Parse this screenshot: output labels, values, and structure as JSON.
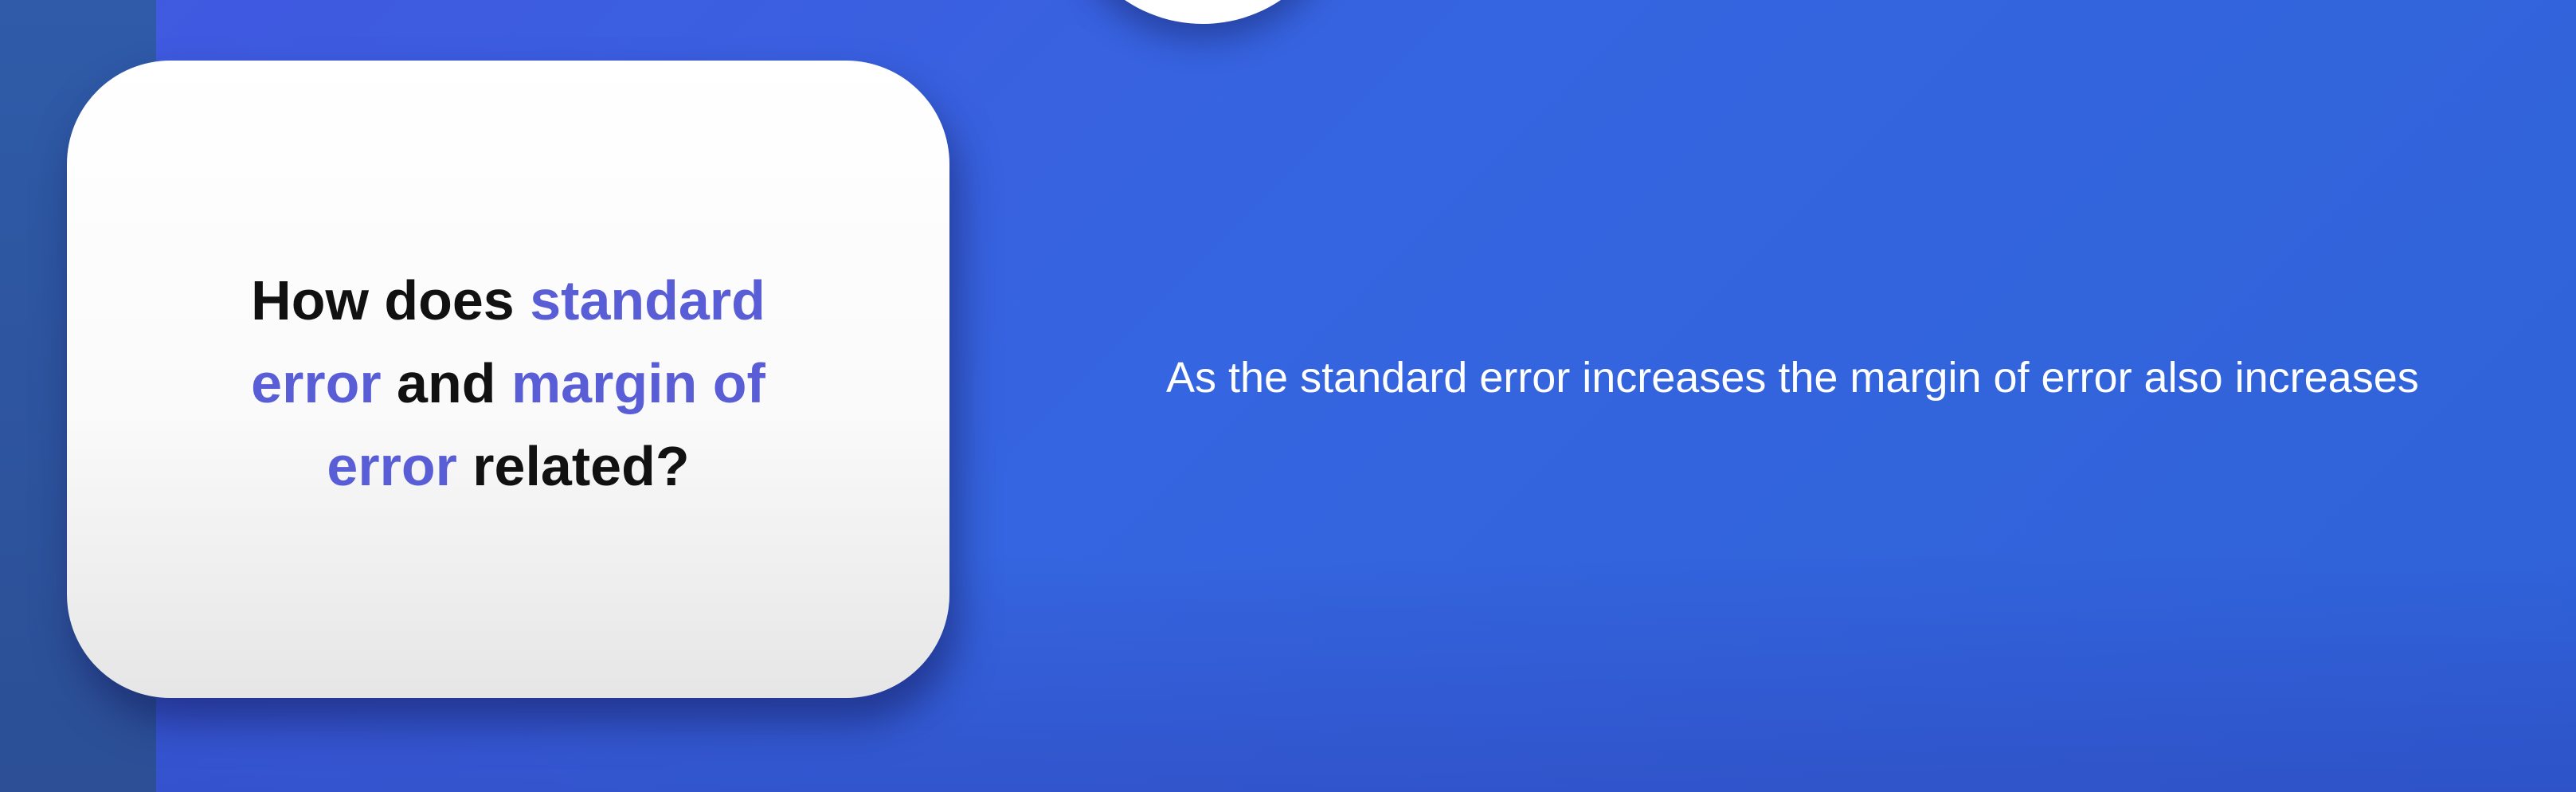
{
  "card": {
    "question_parts": [
      {
        "text": "How does ",
        "highlight": false
      },
      {
        "text": "standard error",
        "highlight": true
      },
      {
        "text": " and ",
        "highlight": false
      },
      {
        "text": "margin of error",
        "highlight": true
      },
      {
        "text": " related?",
        "highlight": false
      }
    ]
  },
  "answer": {
    "text": "As the standard error increases the margin of error also increases"
  },
  "colors": {
    "background": "#3a5ee0",
    "highlight": "#5a5ed6",
    "card": "#ffffff"
  }
}
